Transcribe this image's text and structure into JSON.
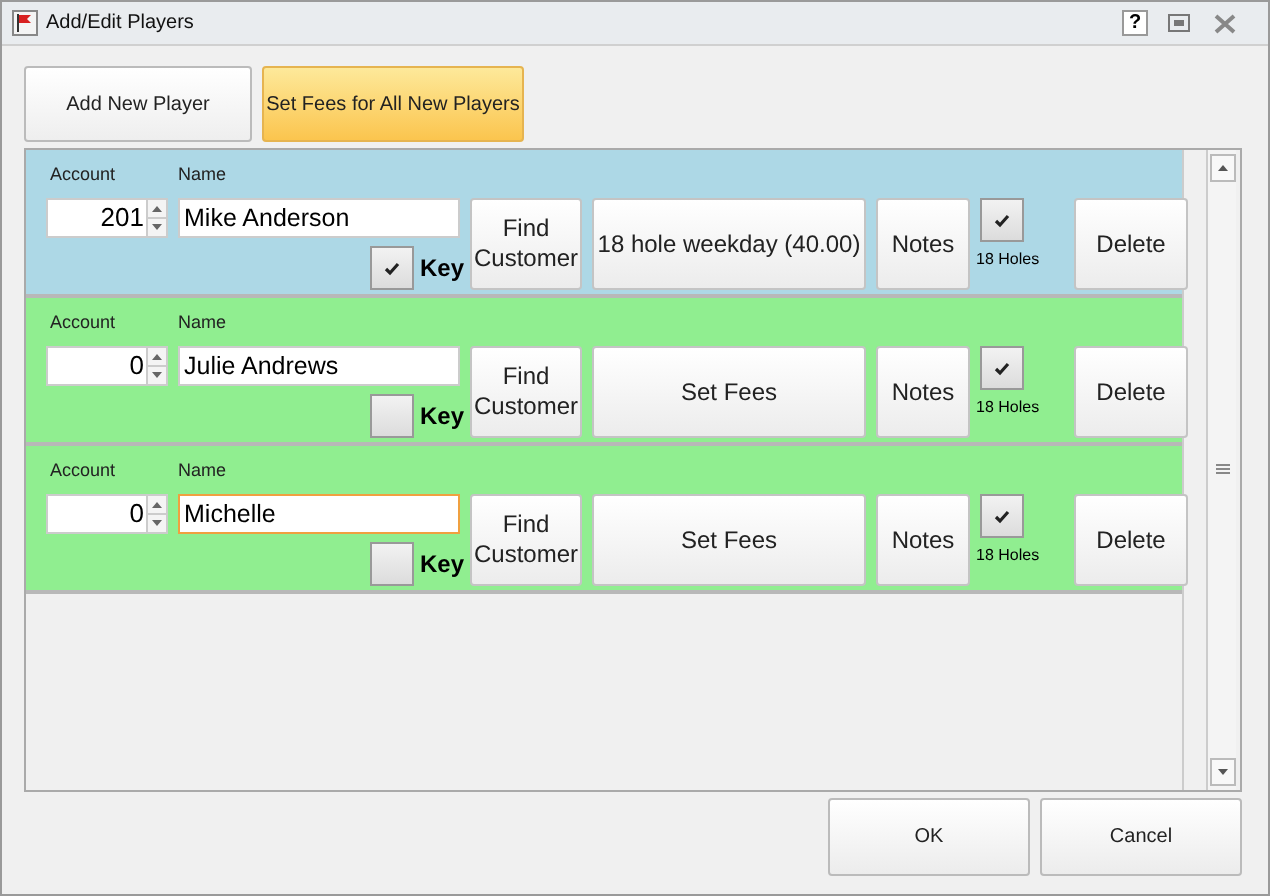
{
  "window": {
    "title": "Add/Edit Players",
    "help": "?"
  },
  "top_buttons": [
    {
      "label": "Add New Player",
      "highlighted": false
    },
    {
      "label": "Set Fees for All New Players",
      "highlighted": true
    }
  ],
  "players": [
    {
      "color": "#add8e6",
      "account_label": "Account",
      "account": "201",
      "name_label": "Name",
      "name": "Mike Anderson",
      "focused": false,
      "key_label": "Key",
      "key_checked": true,
      "find_button": "Find Customer",
      "fees_button": "18 hole weekday (40.00)",
      "notes_button": "Notes",
      "holes_label": "18 Holes",
      "holes_checked": true,
      "delete_button": "Delete"
    },
    {
      "color": "#90ee90",
      "account_label": "Account",
      "account": "0",
      "name_label": "Name",
      "name": "Julie Andrews",
      "focused": false,
      "key_label": "Key",
      "key_checked": false,
      "find_button": "Find Customer",
      "fees_button": "Set Fees",
      "notes_button": "Notes",
      "holes_label": "18 Holes",
      "holes_checked": true,
      "delete_button": "Delete"
    },
    {
      "color": "#90ee90",
      "account_label": "Account",
      "account": "0",
      "name_label": "Name",
      "name": "Michelle",
      "focused": true,
      "key_label": "Key",
      "key_checked": false,
      "find_button": "Find Customer",
      "fees_button": "Set Fees",
      "notes_button": "Notes",
      "holes_label": "18 Holes",
      "holes_checked": true,
      "delete_button": "Delete"
    }
  ],
  "dialog_buttons": [
    {
      "label": "OK"
    },
    {
      "label": "Cancel"
    }
  ]
}
